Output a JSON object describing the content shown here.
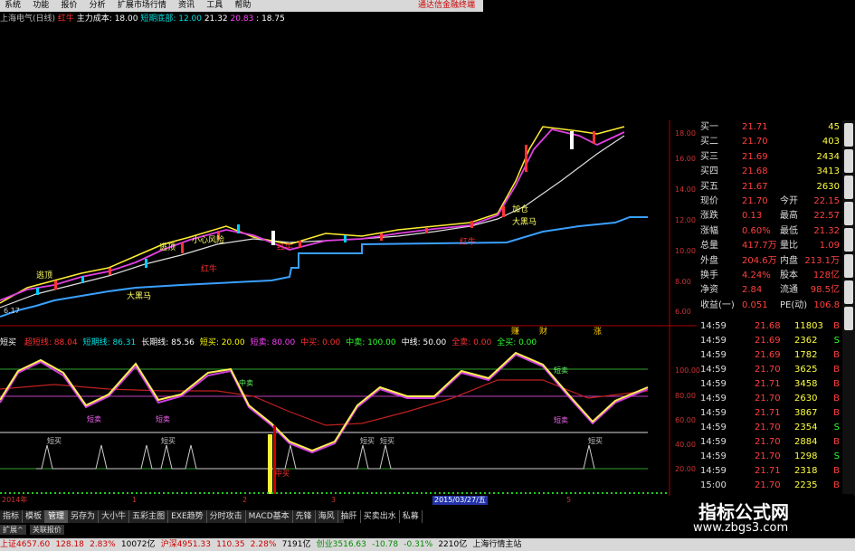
{
  "menu": {
    "items": [
      "系统",
      "功能",
      "报价",
      "分析",
      "扩展市场行情",
      "资讯",
      "工具",
      "帮助"
    ],
    "right": "通达信金融终端"
  },
  "title": {
    "stock": "上海电气(日线)",
    "hongniu": "红牛",
    "cost_label": "主力成本: 18.00",
    "short_label": "短期底部: 12.00",
    "v1": "21.32",
    "v2": "20.83",
    "v3": ": 18.75"
  },
  "price_axis": [
    "18.00",
    "16.00",
    "14.00",
    "12.00",
    "10.00",
    "8.00",
    "6.00"
  ],
  "annotations": {
    "escape1": "逃顶",
    "escape2": "逃顶",
    "small": "小心风险",
    "dahei": "大黑马",
    "hongniu1": "红牛",
    "hongniu2": "红牛",
    "hongniu3": "红牛",
    "jiacang": "加仓",
    "dahei2": "大黑马",
    "low_val": "6.17",
    "buy_marks": [
      "赚",
      "财",
      "涨"
    ]
  },
  "quote": {
    "rows": [
      {
        "label": "买一",
        "price": "21.71",
        "vol": "45"
      },
      {
        "label": "买二",
        "price": "21.70",
        "vol": "403"
      },
      {
        "label": "买三",
        "price": "21.69",
        "vol": "2434"
      },
      {
        "label": "买四",
        "price": "21.68",
        "vol": "3413"
      },
      {
        "label": "买五",
        "price": "21.67",
        "vol": "2630"
      }
    ],
    "stats": [
      {
        "l1": "现价",
        "v1": "21.70",
        "l2": "今开",
        "v2": "22.15"
      },
      {
        "l1": "涨跌",
        "v1": "0.13",
        "l2": "最高",
        "v2": "22.57"
      },
      {
        "l1": "涨幅",
        "v1": "0.60%",
        "l2": "最低",
        "v2": "21.32"
      },
      {
        "l1": "总量",
        "v1": "417.7万",
        "l2": "量比",
        "v2": "1.09"
      },
      {
        "l1": "外盘",
        "v1": "204.6万",
        "l2": "内盘",
        "v2": "213.1万"
      },
      {
        "l1": "换手",
        "v1": "4.24%",
        "l2": "股本",
        "v2": "128亿"
      },
      {
        "l1": "净资",
        "v1": "2.84",
        "l2": "流通",
        "v2": "98.5亿"
      },
      {
        "l1": "收益(一)",
        "v1": "0.051",
        "l2": "PE(动)",
        "v2": "106.8"
      }
    ]
  },
  "ticks": [
    {
      "time": "14:59",
      "price": "21.68",
      "vol": "11803",
      "side": "B"
    },
    {
      "time": "14:59",
      "price": "21.69",
      "vol": "2362",
      "side": "S"
    },
    {
      "time": "14:59",
      "price": "21.69",
      "vol": "1782",
      "side": "B"
    },
    {
      "time": "14:59",
      "price": "21.70",
      "vol": "3625",
      "side": "B"
    },
    {
      "time": "14:59",
      "price": "21.71",
      "vol": "3458",
      "side": "B"
    },
    {
      "time": "14:59",
      "price": "21.70",
      "vol": "2630",
      "side": "B"
    },
    {
      "time": "14:59",
      "price": "21.71",
      "vol": "3867",
      "side": "B"
    },
    {
      "time": "14:59",
      "price": "21.70",
      "vol": "2354",
      "side": "S"
    },
    {
      "time": "14:59",
      "price": "21.70",
      "vol": "2884",
      "side": "B"
    },
    {
      "time": "14:59",
      "price": "21.70",
      "vol": "1298",
      "side": "S"
    },
    {
      "time": "14:59",
      "price": "21.71",
      "vol": "2318",
      "side": "B"
    },
    {
      "time": "15:00",
      "price": "21.70",
      "vol": "2235",
      "side": "B"
    }
  ],
  "indicator": {
    "name": "短买",
    "items": [
      {
        "label": "超短线: 88.04",
        "color": "#ff3030"
      },
      {
        "label": "短期线: 86.31",
        "color": "#00e0e0"
      },
      {
        "label": "长期线: 85.56",
        "color": "#ffffff"
      },
      {
        "label": "短买: 20.00",
        "color": "#ffff00"
      },
      {
        "label": "短卖: 80.00",
        "color": "#ff40ff"
      },
      {
        "label": "中买: 0.00",
        "color": "#ff3030"
      },
      {
        "label": "中卖: 100.00",
        "color": "#30ff30"
      },
      {
        "label": "中线: 50.00",
        "color": "#ffffff"
      },
      {
        "label": "全卖: 0.00",
        "color": "#ff3030"
      },
      {
        "label": "全买: 0.00",
        "color": "#30ff30"
      }
    ],
    "axis": [
      "100.00",
      "80.00",
      "60.00",
      "40.00",
      "20.00"
    ],
    "labels": [
      "短卖",
      "短卖",
      "中卖",
      "短卖",
      "短买",
      "短买",
      "短买",
      "短买",
      "短买",
      "中买",
      "短卖"
    ]
  },
  "dates": {
    "y": "2014年",
    "m1": "1",
    "m2": "2",
    "m3": "3",
    "sel": "2015/03/27/五",
    "m5": "5"
  },
  "tabs": [
    "指标",
    "模板",
    "管理",
    "另存为",
    "大小牛",
    "五彩主图",
    "EXE趋势",
    "分时攻击",
    "MACD基本",
    "先锋",
    "海风",
    "抽肝",
    "买卖出水",
    "私募"
  ],
  "active_tab": "管理",
  "subtabs": [
    "扩展^",
    "关联报价"
  ],
  "status": {
    "sh": "上证4657.60",
    "sh_chg": "128.18",
    "sh_pct": "2.83%",
    "sh_amt": "10072亿",
    "sz": "沪深4951.33",
    "sz_chg": "110.35",
    "sz_pct": "2.28%",
    "sz_amt": "7191亿",
    "cy": "创业3516.63",
    "cy_chg": "-10.78",
    "cy_pct": "-0.31%",
    "cy_amt": "2210亿",
    "site": "上海行情主站"
  },
  "watermark": {
    "name": "指标公式网",
    "url": "www.zbgs3.com"
  }
}
